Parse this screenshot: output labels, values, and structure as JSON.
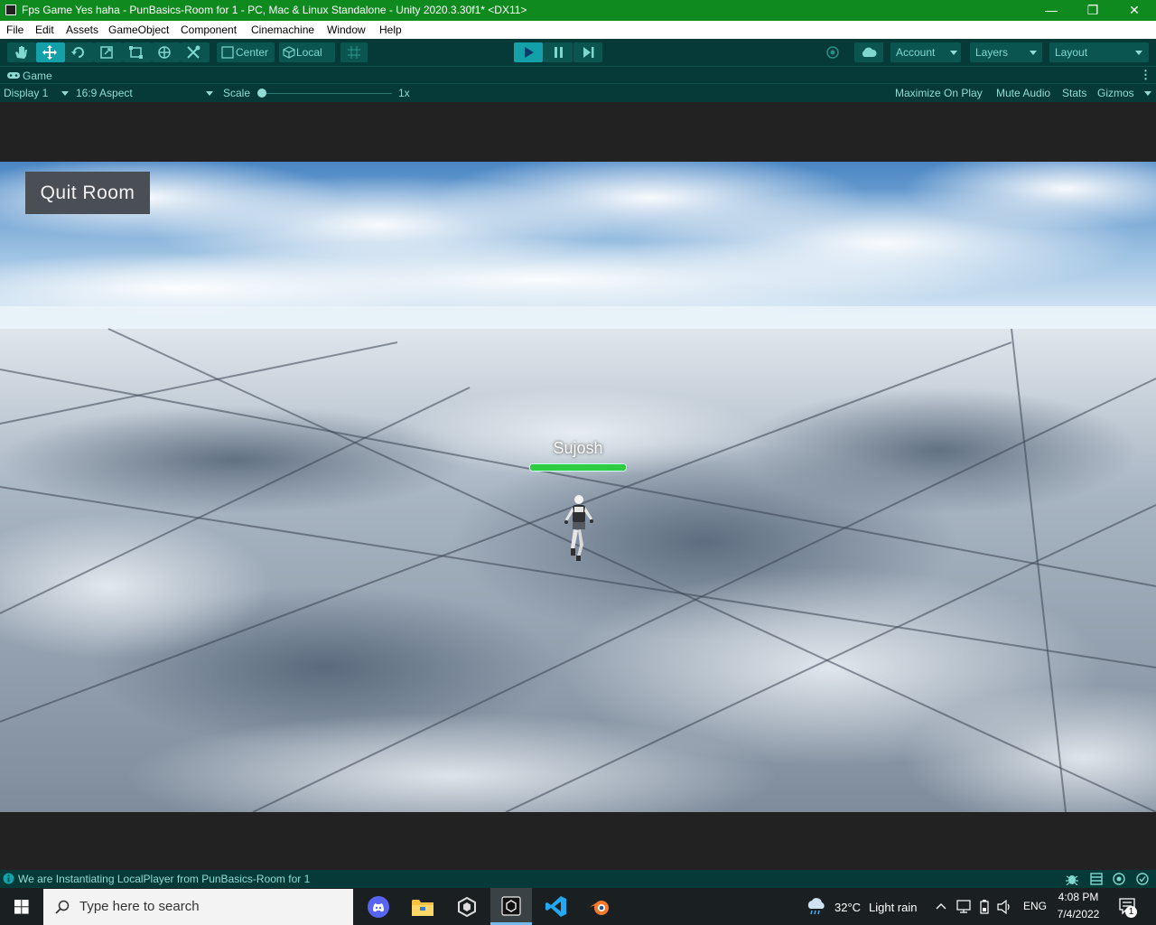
{
  "window": {
    "title": "Fps Game Yes haha - PunBasics-Room for 1 - PC, Mac & Linux Standalone - Unity 2020.3.30f1* <DX11>",
    "controls": {
      "minimize": "—",
      "restore": "❐",
      "close": "✕"
    }
  },
  "menu": [
    "File",
    "Edit",
    "Assets",
    "GameObject",
    "Component",
    "Cinemachine",
    "Window",
    "Help"
  ],
  "toolbar": {
    "pivot_label": "Center",
    "space_label": "Local",
    "account_label": "Account",
    "layers_label": "Layers",
    "layout_label": "Layout"
  },
  "game_tab": {
    "label": "Game",
    "display": "Display 1",
    "aspect": "16:9 Aspect",
    "scale_label": "Scale",
    "scale_value": "1x",
    "maximize_on_play": "Maximize On Play",
    "mute_audio": "Mute Audio",
    "stats": "Stats",
    "gizmos": "Gizmos"
  },
  "game": {
    "quit_button": "Quit Room",
    "player_name": "Sujosh",
    "player_health": 1.0
  },
  "status": {
    "message": "We are Instantiating LocalPlayer from PunBasics-Room for 1"
  },
  "taskbar": {
    "search_placeholder": "Type here to search",
    "weather_temp": "32°C",
    "weather_desc": "Light rain",
    "language": "ENG",
    "time": "4:08 PM",
    "date": "7/4/2022",
    "notification_count": "1"
  },
  "colors": {
    "titlebar": "#0f8a1e",
    "editor_bg": "#063a38",
    "accent": "#13a0a8",
    "health_bar": "#2ecc40"
  }
}
